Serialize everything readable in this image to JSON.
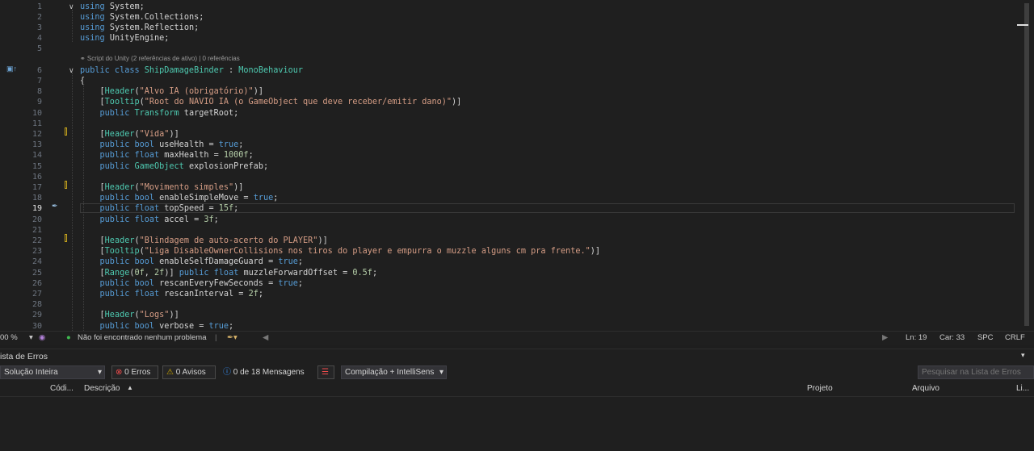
{
  "codelens": "⚭ Script do Unity (2 referências de ativo) | 0 referências",
  "lines": [
    {
      "n": "1",
      "tokens": [
        {
          "c": "k",
          "t": "using "
        },
        {
          "c": "",
          "t": "System;"
        }
      ]
    },
    {
      "n": "2",
      "tokens": [
        {
          "c": "k",
          "t": "using "
        },
        {
          "c": "",
          "t": "System.Collections;"
        }
      ]
    },
    {
      "n": "3",
      "tokens": [
        {
          "c": "k",
          "t": "using "
        },
        {
          "c": "",
          "t": "System.Reflection;"
        }
      ]
    },
    {
      "n": "4",
      "tokens": [
        {
          "c": "k",
          "t": "using "
        },
        {
          "c": "",
          "t": "UnityEngine;"
        }
      ]
    },
    {
      "n": "5",
      "tokens": []
    },
    {
      "n": "6",
      "tokens": [
        {
          "c": "k",
          "t": "public class "
        },
        {
          "c": "t",
          "t": "ShipDamageBinder"
        },
        {
          "c": "",
          "t": " : "
        },
        {
          "c": "t",
          "t": "MonoBehaviour"
        }
      ]
    },
    {
      "n": "7",
      "tokens": [
        {
          "c": "",
          "t": "{"
        }
      ]
    },
    {
      "n": "8",
      "tokens": [
        {
          "c": "",
          "t": "    ["
        },
        {
          "c": "a",
          "t": "Header"
        },
        {
          "c": "",
          "t": "("
        },
        {
          "c": "s",
          "t": "\"Alvo IA (obrigatório)\""
        },
        {
          "c": "",
          "t": ")]"
        }
      ]
    },
    {
      "n": "9",
      "tokens": [
        {
          "c": "",
          "t": "    ["
        },
        {
          "c": "a",
          "t": "Tooltip"
        },
        {
          "c": "",
          "t": "("
        },
        {
          "c": "s",
          "t": "\"Root do NAVIO IA (o GameObject que deve receber/emitir dano)\""
        },
        {
          "c": "",
          "t": ")]"
        }
      ]
    },
    {
      "n": "10",
      "tokens": [
        {
          "c": "k",
          "t": "    public "
        },
        {
          "c": "t",
          "t": "Transform"
        },
        {
          "c": "",
          "t": " targetRoot;"
        }
      ]
    },
    {
      "n": "11",
      "tokens": []
    },
    {
      "n": "12",
      "tokens": [
        {
          "c": "",
          "t": "    ["
        },
        {
          "c": "a",
          "t": "Header"
        },
        {
          "c": "",
          "t": "("
        },
        {
          "c": "s",
          "t": "\"Vida\""
        },
        {
          "c": "",
          "t": ")]"
        }
      ]
    },
    {
      "n": "13",
      "tokens": [
        {
          "c": "k",
          "t": "    public bool "
        },
        {
          "c": "",
          "t": "useHealth = "
        },
        {
          "c": "k",
          "t": "true"
        },
        {
          "c": "",
          "t": ";"
        }
      ]
    },
    {
      "n": "14",
      "tokens": [
        {
          "c": "k",
          "t": "    public float "
        },
        {
          "c": "",
          "t": "maxHealth = "
        },
        {
          "c": "n",
          "t": "1000f"
        },
        {
          "c": "",
          "t": ";"
        }
      ]
    },
    {
      "n": "15",
      "tokens": [
        {
          "c": "k",
          "t": "    public "
        },
        {
          "c": "t",
          "t": "GameObject"
        },
        {
          "c": "",
          "t": " explosionPrefab;"
        }
      ]
    },
    {
      "n": "16",
      "tokens": []
    },
    {
      "n": "17",
      "tokens": [
        {
          "c": "",
          "t": "    ["
        },
        {
          "c": "a",
          "t": "Header"
        },
        {
          "c": "",
          "t": "("
        },
        {
          "c": "s",
          "t": "\"Movimento simples\""
        },
        {
          "c": "",
          "t": ")]"
        }
      ]
    },
    {
      "n": "18",
      "tokens": [
        {
          "c": "k",
          "t": "    public bool "
        },
        {
          "c": "",
          "t": "enableSimpleMove = "
        },
        {
          "c": "k",
          "t": "true"
        },
        {
          "c": "",
          "t": ";"
        }
      ]
    },
    {
      "n": "19",
      "tokens": [
        {
          "c": "k",
          "t": "    public float "
        },
        {
          "c": "",
          "t": "topSpeed = "
        },
        {
          "c": "n",
          "t": "15f"
        },
        {
          "c": "",
          "t": ";"
        }
      ]
    },
    {
      "n": "20",
      "tokens": [
        {
          "c": "k",
          "t": "    public float "
        },
        {
          "c": "",
          "t": "accel = "
        },
        {
          "c": "n",
          "t": "3f"
        },
        {
          "c": "",
          "t": ";"
        }
      ]
    },
    {
      "n": "21",
      "tokens": []
    },
    {
      "n": "22",
      "tokens": [
        {
          "c": "",
          "t": "    ["
        },
        {
          "c": "a",
          "t": "Header"
        },
        {
          "c": "",
          "t": "("
        },
        {
          "c": "s",
          "t": "\"Blindagem de auto-acerto do PLAYER\""
        },
        {
          "c": "",
          "t": ")]"
        }
      ]
    },
    {
      "n": "23",
      "tokens": [
        {
          "c": "",
          "t": "    ["
        },
        {
          "c": "a",
          "t": "Tooltip"
        },
        {
          "c": "",
          "t": "("
        },
        {
          "c": "s",
          "t": "\"Liga DisableOwnerCollisions nos tiros do player e empurra o muzzle alguns cm pra frente.\""
        },
        {
          "c": "",
          "t": ")]"
        }
      ]
    },
    {
      "n": "24",
      "tokens": [
        {
          "c": "k",
          "t": "    public bool "
        },
        {
          "c": "",
          "t": "enableSelfDamageGuard = "
        },
        {
          "c": "k",
          "t": "true"
        },
        {
          "c": "",
          "t": ";"
        }
      ]
    },
    {
      "n": "25",
      "tokens": [
        {
          "c": "",
          "t": "    ["
        },
        {
          "c": "a",
          "t": "Range"
        },
        {
          "c": "",
          "t": "("
        },
        {
          "c": "n",
          "t": "0f"
        },
        {
          "c": "",
          "t": ", "
        },
        {
          "c": "n",
          "t": "2f"
        },
        {
          "c": "",
          "t": ")] "
        },
        {
          "c": "k",
          "t": "public float "
        },
        {
          "c": "",
          "t": "muzzleForwardOffset = "
        },
        {
          "c": "n",
          "t": "0.5f"
        },
        {
          "c": "",
          "t": ";"
        }
      ]
    },
    {
      "n": "26",
      "tokens": [
        {
          "c": "k",
          "t": "    public bool "
        },
        {
          "c": "",
          "t": "rescanEveryFewSeconds = "
        },
        {
          "c": "k",
          "t": "true"
        },
        {
          "c": "",
          "t": ";"
        }
      ]
    },
    {
      "n": "27",
      "tokens": [
        {
          "c": "k",
          "t": "    public float "
        },
        {
          "c": "",
          "t": "rescanInterval = "
        },
        {
          "c": "n",
          "t": "2f"
        },
        {
          "c": "",
          "t": ";"
        }
      ]
    },
    {
      "n": "28",
      "tokens": []
    },
    {
      "n": "29",
      "tokens": [
        {
          "c": "",
          "t": "    ["
        },
        {
          "c": "a",
          "t": "Header"
        },
        {
          "c": "",
          "t": "("
        },
        {
          "c": "s",
          "t": "\"Logs\""
        },
        {
          "c": "",
          "t": ")]"
        }
      ]
    },
    {
      "n": "30",
      "tokens": [
        {
          "c": "k",
          "t": "    public bool "
        },
        {
          "c": "",
          "t": "verbose = "
        },
        {
          "c": "k",
          "t": "true"
        },
        {
          "c": "",
          "t": ";"
        }
      ]
    }
  ],
  "status": {
    "zoom": "00 %",
    "problems": "Não foi encontrado nenhum problema",
    "ln": "Ln: 19",
    "car": "Car: 33",
    "spc": "SPC",
    "crlf": "CRLF"
  },
  "errors_panel": {
    "title": "ista de Erros",
    "scope": "Solução Inteira",
    "errors": "0 Erros",
    "warnings": "0 Avisos",
    "messages": "0 de 18 Mensagens",
    "build_filter": "Compilação + IntelliSens",
    "search_placeholder": "Pesquisar na Lista de Erros",
    "columns": {
      "code": "Códi...",
      "description": "Descrição",
      "project": "Projeto",
      "file": "Arquivo",
      "line": "Li..."
    }
  }
}
